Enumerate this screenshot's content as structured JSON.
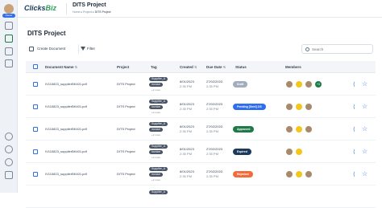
{
  "sidebar": {
    "badge": "Owner",
    "icons": [
      "grid-icon",
      "document-icon",
      "folder-icon",
      "inbox-icon",
      "settings-icon",
      "cog-icon",
      "help-icon",
      "logout-icon"
    ]
  },
  "header": {
    "logo_main": "Clicks",
    "logo_accent": "Biz",
    "title": "DITS Project",
    "crumb_home": "Home",
    "crumb_mid": "Project",
    "crumb_current": "DITS Project"
  },
  "page": {
    "title": "DITS Project"
  },
  "toolbar": {
    "create_label": "Create Document",
    "filter_label": "Filter",
    "search_placeholder": "Search"
  },
  "columns": [
    "Document Name",
    "Project",
    "Tag",
    "Created",
    "Due Date",
    "Status",
    "Members"
  ],
  "rows": [
    {
      "name": "IV110823_supplierBK401.pdf",
      "project": "DITS Project",
      "tags": [
        "Supplier_A",
        "Invoice"
      ],
      "more": "+2 more",
      "created_date": "8/01/2023",
      "created_time": "2:35 PM",
      "due_date": "27/02/2023",
      "due_time": "2:35 PM",
      "status": "Draft",
      "status_color": "#a0aec0",
      "members_extra": "+3"
    },
    {
      "name": "IV110823_supplierBK401.pdf",
      "project": "DITS Project",
      "tags": [
        "Supplier_A",
        "Invoice"
      ],
      "more": "+2 more",
      "created_date": "8/01/2023",
      "created_time": "2:35 PM",
      "due_date": "27/02/2023",
      "due_time": "2:35 PM",
      "status": "Pending [Sent] 2/3",
      "status_color": "#2f6fed",
      "members_extra": ""
    },
    {
      "name": "IV110823_supplierBK401.pdf",
      "project": "DITS Project",
      "tags": [
        "Supplier_A",
        "Invoice"
      ],
      "more": "+2 more",
      "created_date": "8/01/2023",
      "created_time": "2:35 PM",
      "due_date": "27/02/2023",
      "due_time": "2:35 PM",
      "status": "Approved",
      "status_color": "#1f7a4a",
      "members_extra": ""
    },
    {
      "name": "IV110823_supplierBK401.pdf",
      "project": "DITS Project",
      "tags": [
        "Supplier_A",
        "Invoice"
      ],
      "more": "+2 more",
      "created_date": "8/01/2023",
      "created_time": "2:35 PM",
      "due_date": "27/02/2023",
      "due_time": "2:35 PM",
      "status": "Expired",
      "status_color": "#1b3a5c",
      "members_extra": ""
    },
    {
      "name": "IV110823_supplierBK401.pdf",
      "project": "DITS Project",
      "tags": [
        "Supplier_A",
        "Invoice"
      ],
      "more": "+2 more",
      "created_date": "8/01/2023",
      "created_time": "2:35 PM",
      "due_date": "27/02/2023",
      "due_time": "2:35 PM",
      "status": "Rejected",
      "status_color": "#f26b3a",
      "members_extra": ""
    },
    {
      "tags": [
        "Supplier_A"
      ]
    }
  ]
}
